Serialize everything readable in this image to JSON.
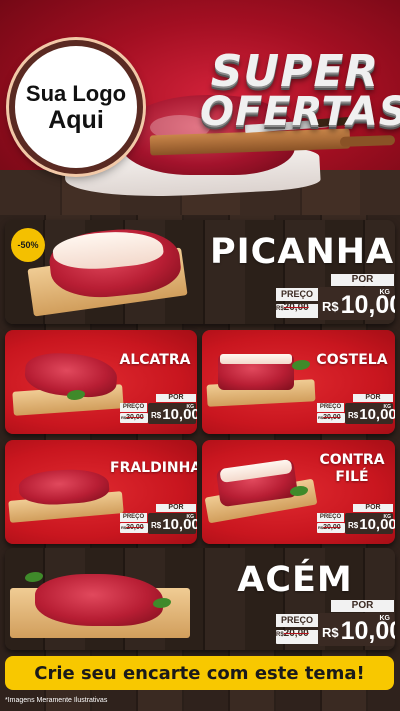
{
  "header": {
    "logo_line1": "Sua Logo",
    "logo_line2": "Aqui",
    "title_line1": "SUPER",
    "title_line2": "OFERTAS"
  },
  "products": [
    {
      "name": "PICANHA",
      "discount": "-50%",
      "por_label": "POR",
      "preco_label": "PREÇO",
      "old_price_prefix": "R$",
      "old_price": "20,00",
      "currency": "R$",
      "price": "10,00",
      "unit": "KG"
    },
    {
      "name": "ALCATRA",
      "por_label": "POR",
      "preco_label": "PREÇO",
      "old_price_prefix": "R$",
      "old_price": "20,00",
      "currency": "R$",
      "price": "10,00",
      "unit": "KG"
    },
    {
      "name": "COSTELA",
      "por_label": "POR",
      "preco_label": "PREÇO",
      "old_price_prefix": "R$",
      "old_price": "20,00",
      "currency": "R$",
      "price": "10,00",
      "unit": "KG"
    },
    {
      "name": "FRALDINHA",
      "por_label": "POR",
      "preco_label": "PREÇO",
      "old_price_prefix": "R$",
      "old_price": "20,00",
      "currency": "R$",
      "price": "10,00",
      "unit": "KG"
    },
    {
      "name_line1": "CONTRA",
      "name_line2": "FILÉ",
      "por_label": "POR",
      "preco_label": "PREÇO",
      "old_price_prefix": "R$",
      "old_price": "20,00",
      "currency": "R$",
      "price": "10,00",
      "unit": "KG"
    },
    {
      "name": "ACÉM",
      "por_label": "POR",
      "preco_label": "PREÇO",
      "old_price_prefix": "R$",
      "old_price": "20,00",
      "currency": "R$",
      "price": "10,00",
      "unit": "KG"
    }
  ],
  "banner": {
    "text": "Crie seu encarte com este tema!"
  },
  "footnote": "*Imagens Meramente Ilustrativas",
  "colors": {
    "brand_red": "#c9161f",
    "banner_yellow": "#f8c800",
    "price_box": "#3a2a23",
    "wood_dark": "#2f221c"
  },
  "icons": [
    "meat-photo",
    "cutting-board",
    "knife"
  ]
}
